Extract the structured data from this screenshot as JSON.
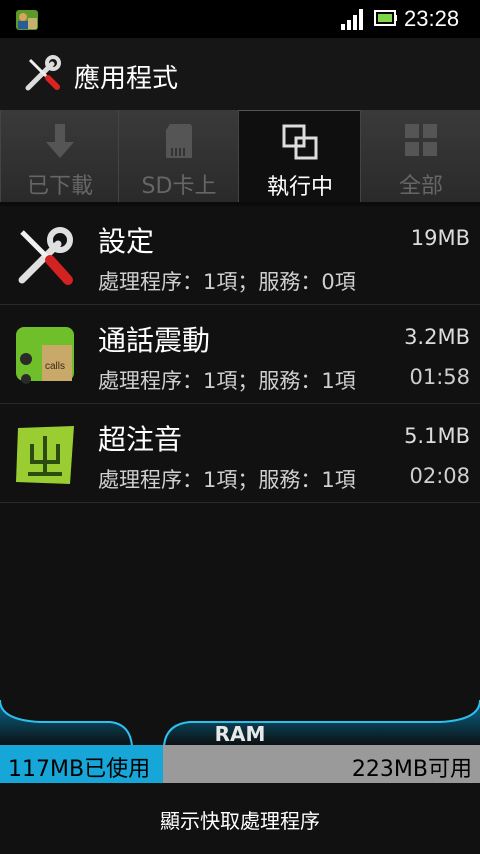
{
  "status_bar": {
    "time": "23:28"
  },
  "app_bar": {
    "title": "應用程式"
  },
  "tabs": [
    {
      "label": "已下載",
      "active": false
    },
    {
      "label": "SD卡上",
      "active": false
    },
    {
      "label": "執行中",
      "active": true
    },
    {
      "label": "全部",
      "active": false
    }
  ],
  "apps": [
    {
      "name": "設定",
      "size": "19MB",
      "detail": "處理程序：1項；服務：0項",
      "time": ""
    },
    {
      "name": "通話震動",
      "size": "3.2MB",
      "detail": "處理程序：1項；服務：1項",
      "time": "01:58"
    },
    {
      "name": "超注音",
      "size": "5.1MB",
      "detail": "處理程序：1項；服務：1項",
      "time": "02:08"
    }
  ],
  "ram": {
    "label": "RAM",
    "used_text": "117MB已使用",
    "free_text": "223MB可用",
    "used_fraction": 0.34
  },
  "footer": {
    "button_label": "顯示快取處理程序"
  },
  "colors": {
    "accent": "#16a6d8",
    "ram_free": "#9a9a9a",
    "background": "#111111"
  }
}
